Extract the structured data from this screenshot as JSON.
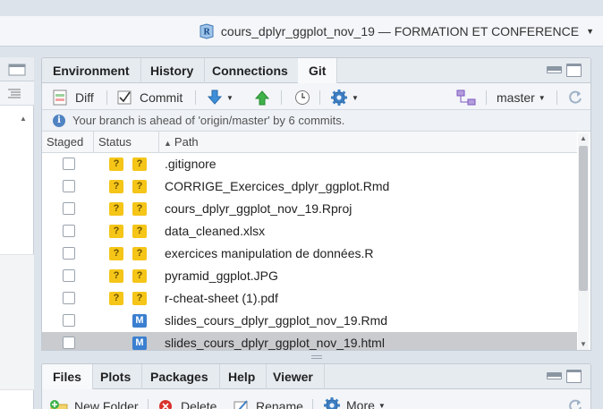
{
  "project": {
    "title": "cours_dplyr_ggplot_nov_19 — FORMATION ET CONFERENCE",
    "icon": "r-project-icon"
  },
  "git_pane": {
    "tabs": [
      {
        "label": "Environment",
        "active": false
      },
      {
        "label": "History",
        "active": false
      },
      {
        "label": "Connections",
        "active": false
      },
      {
        "label": "Git",
        "active": true
      }
    ],
    "toolbar": {
      "diff_label": "Diff",
      "commit_label": "Commit",
      "branch": "master"
    },
    "info": "Your branch is ahead of 'origin/master' by 6 commits.",
    "columns": {
      "staged": "Staged",
      "status": "Status",
      "path": "Path",
      "path_sort_indicator": "▲"
    },
    "files": [
      {
        "path": ".gitignore",
        "status": [
          "?",
          "?"
        ],
        "staged": false,
        "selected": false
      },
      {
        "path": "CORRIGE_Exercices_dplyr_ggplot.Rmd",
        "status": [
          "?",
          "?"
        ],
        "staged": false,
        "selected": false
      },
      {
        "path": "cours_dplyr_ggplot_nov_19.Rproj",
        "status": [
          "?",
          "?"
        ],
        "staged": false,
        "selected": false
      },
      {
        "path": "data_cleaned.xlsx",
        "status": [
          "?",
          "?"
        ],
        "staged": false,
        "selected": false
      },
      {
        "path": "exercices manipulation de données.R",
        "status": [
          "?",
          "?"
        ],
        "staged": false,
        "selected": false
      },
      {
        "path": "pyramid_ggplot.JPG",
        "status": [
          "?",
          "?"
        ],
        "staged": false,
        "selected": false
      },
      {
        "path": "r-cheat-sheet (1).pdf",
        "status": [
          "?",
          "?"
        ],
        "staged": false,
        "selected": false
      },
      {
        "path": "slides_cours_dplyr_ggplot_nov_19.Rmd",
        "status": [
          "",
          "M"
        ],
        "staged": false,
        "selected": false
      },
      {
        "path": "slides_cours_dplyr_ggplot_nov_19.html",
        "status": [
          "",
          "M"
        ],
        "staged": false,
        "selected": true
      }
    ]
  },
  "files_pane": {
    "tabs": [
      {
        "label": "Files",
        "active": true
      },
      {
        "label": "Plots",
        "active": false
      },
      {
        "label": "Packages",
        "active": false
      },
      {
        "label": "Help",
        "active": false
      },
      {
        "label": "Viewer",
        "active": false
      }
    ],
    "toolbar": {
      "new_folder_label": "New Folder",
      "delete_label": "Delete",
      "rename_label": "Rename",
      "more_label": "More"
    }
  },
  "colors": {
    "untracked_badge": "#f5c518",
    "modified_badge": "#3b7fd0",
    "info_icon": "#4f83c2"
  }
}
